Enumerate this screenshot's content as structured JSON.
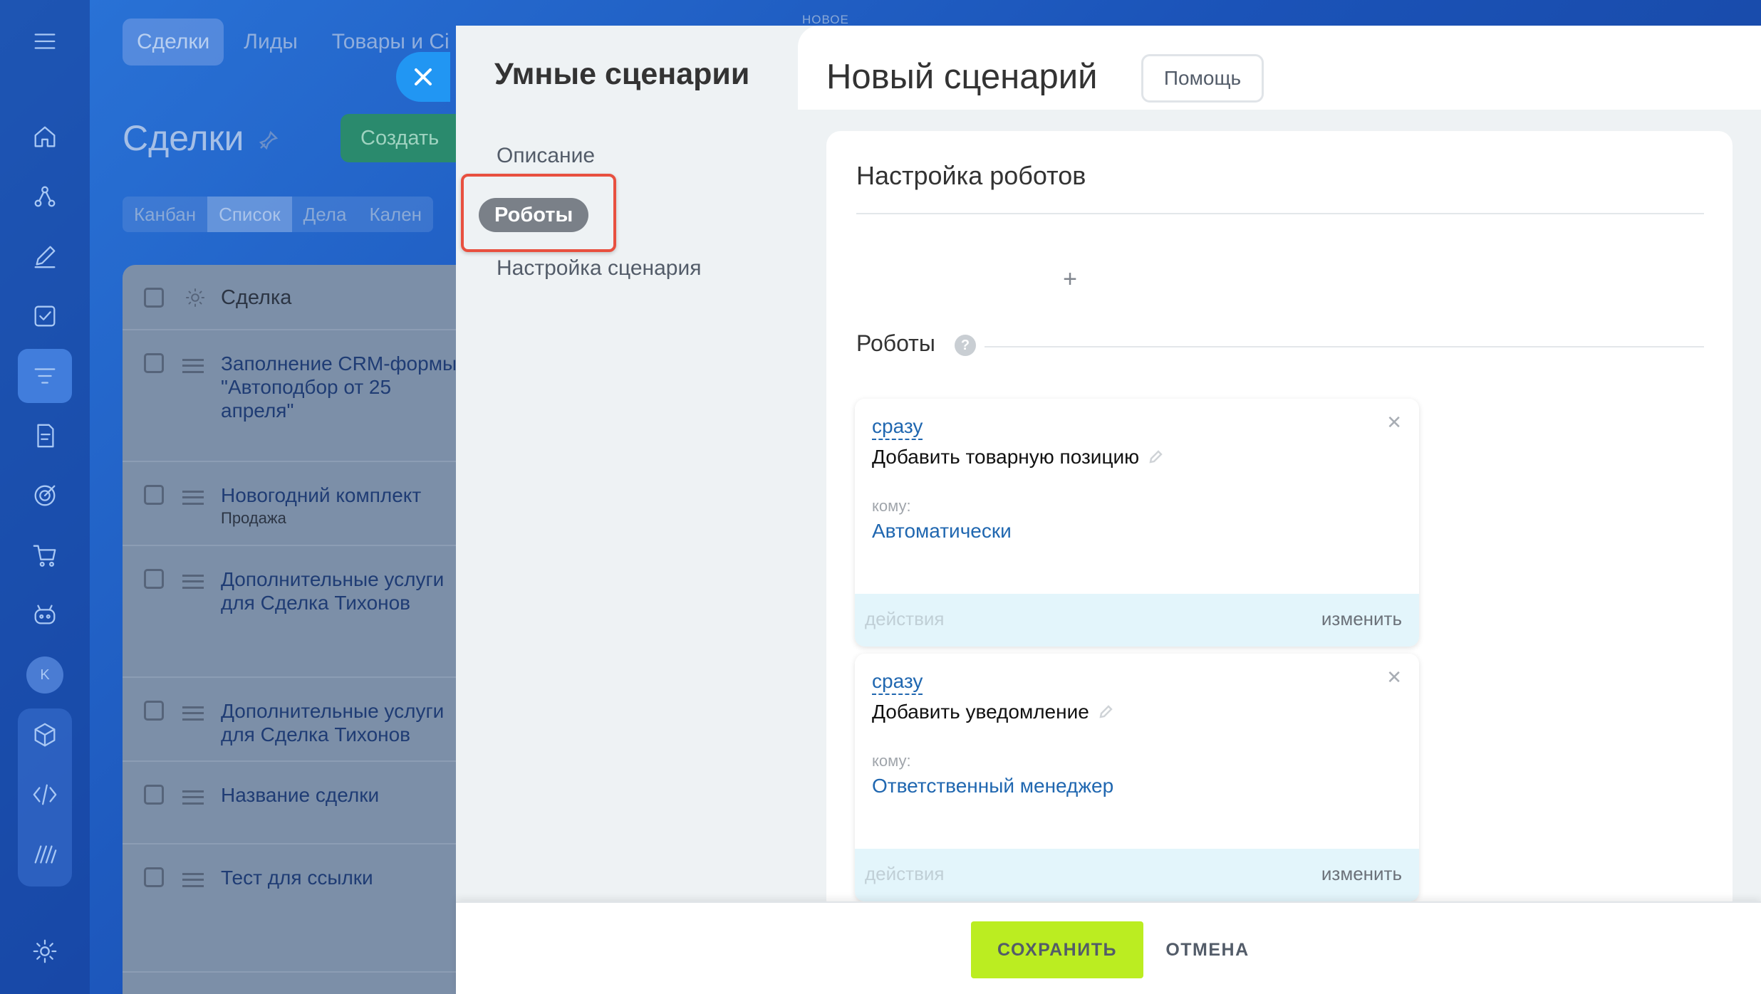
{
  "background": {
    "top_tabs": [
      "Сделки",
      "Лиды",
      "Товары и Сі"
    ],
    "new_badge": "НОВОЕ",
    "page_title": "Сделки",
    "create_label": "Создать",
    "view_tabs": [
      "Канбан",
      "Список",
      "Дела",
      "Кален"
    ],
    "avatar_letter": "K",
    "grid_header": "Сделка",
    "rows": [
      {
        "title": "Заполнение CRM-формы\n\"Автоподбор от 25\nапреля\"",
        "subtitle": ""
      },
      {
        "title": "Новогодний комплект",
        "subtitle": "Продажа"
      },
      {
        "title": "Дополнительные услуги\nдля Сделка Тихонов",
        "subtitle": ""
      },
      {
        "title": "Дополнительные услуги\nдля Сделка Тихонов",
        "subtitle": ""
      },
      {
        "title": "Название сделки",
        "subtitle": ""
      },
      {
        "title": "Тест для ссылки",
        "subtitle": ""
      }
    ]
  },
  "slider": {
    "title": "Умные сценарии",
    "nav": {
      "description": "Описание",
      "robots": "Роботы",
      "settings": "Настройка сценария"
    },
    "main_title": "Новый сценарий",
    "help_label": "Помощь",
    "section_title": "Настройка роботов",
    "add_symbol": "+",
    "robots_label": "Роботы",
    "help_symbol": "?",
    "robots": [
      {
        "delay": "сразу",
        "name": "Добавить товарную позицию",
        "to_label": "кому:",
        "to_value": "Автоматически",
        "actions": "действия",
        "edit": "изменить"
      },
      {
        "delay": "сразу",
        "name": "Добавить уведомление",
        "to_label": "кому:",
        "to_value": "Ответственный менеджер",
        "actions": "действия",
        "edit": "изменить"
      }
    ],
    "save_label": "СОХРАНИТЬ",
    "cancel_label": "ОТМЕНА"
  },
  "colors": {
    "accent_blue": "#2196f3",
    "save_green": "#bbed21",
    "highlight_red": "#e8503f",
    "link_blue": "#2067b0"
  }
}
